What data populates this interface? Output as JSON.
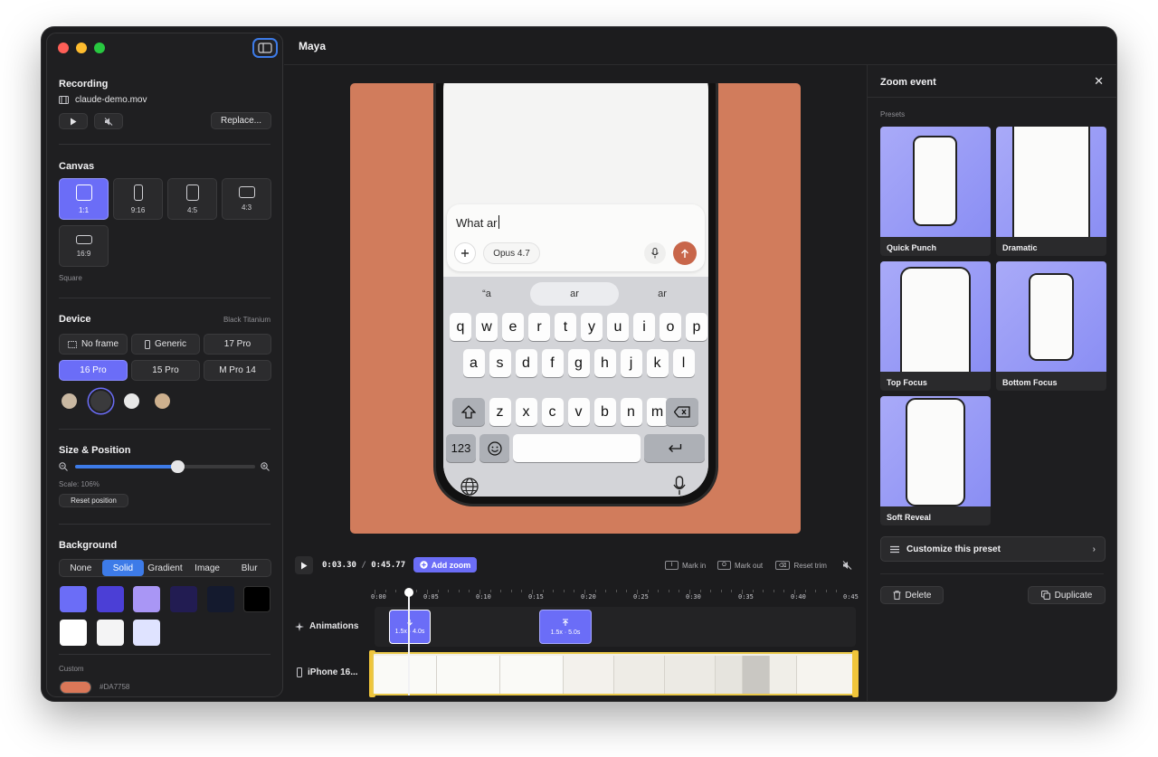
{
  "window": {
    "title": "Maya"
  },
  "recording": {
    "title": "Recording",
    "file_name": "claude-demo.mov",
    "replace_label": "Replace..."
  },
  "canvas": {
    "title": "Canvas",
    "options": [
      "1:1",
      "9:16",
      "4:5",
      "4:3",
      "16:9"
    ],
    "selected": "1:1",
    "selected_name": "Square"
  },
  "device": {
    "title": "Device",
    "finish": "Black Titanium",
    "options": [
      "No frame",
      "Generic",
      "17 Pro",
      "16 Pro",
      "15 Pro",
      "M Pro 14"
    ],
    "selected": "16 Pro",
    "colors": [
      "#c9b8a2",
      "#3a3a3c",
      "#e8e8e8",
      "#cdb08e"
    ]
  },
  "size_position": {
    "title": "Size & Position",
    "scale_text": "Scale: 106%",
    "slider_fraction": 0.57,
    "reset_label": "Reset position"
  },
  "background": {
    "title": "Background",
    "tabs": [
      "None",
      "Solid",
      "Gradient",
      "Image",
      "Blur"
    ],
    "selected_tab": "Solid",
    "swatches": [
      "#6b6df7",
      "#4b3fd6",
      "#a996f5",
      "#221c52",
      "#141a2e",
      "#000000",
      "#ffffff",
      "#f4f4f5",
      "#dfe3ff"
    ],
    "custom_label": "Custom",
    "custom_color": "#DA7758"
  },
  "preview": {
    "input_text": "What ar",
    "model_label": "Opus 4.7",
    "suggestions": [
      "“a",
      "ar",
      "ar"
    ],
    "rows": [
      [
        "q",
        "w",
        "e",
        "r",
        "t",
        "y",
        "u",
        "i",
        "o",
        "p"
      ],
      [
        "a",
        "s",
        "d",
        "f",
        "g",
        "h",
        "j",
        "k",
        "l"
      ],
      [
        "z",
        "x",
        "c",
        "v",
        "b",
        "n",
        "m"
      ]
    ],
    "numbers_key": "123"
  },
  "timeline": {
    "current_time": "0:03.30",
    "separator": "/",
    "total_time": "0:45.77",
    "add_zoom_label": "Add zoom",
    "mark_in": {
      "key": "I",
      "label": "Mark in"
    },
    "mark_out": {
      "key": "O",
      "label": "Mark out"
    },
    "reset_trim": "Reset trim",
    "ticks": [
      "0:00",
      "0:05",
      "0:10",
      "0:15",
      "0:20",
      "0:25",
      "0:30",
      "0:35",
      "0:40",
      "0:45"
    ],
    "tracks": {
      "animations": "Animations",
      "video": "iPhone 16..."
    },
    "clips": [
      {
        "scale": "1.5x",
        "duration": "4.0s"
      },
      {
        "scale": "1.5x",
        "duration": "5.0s"
      }
    ],
    "playhead_seconds": 3.3
  },
  "zoom_event": {
    "title": "Zoom event",
    "presets_label": "Presets",
    "presets": [
      "Quick Punch",
      "Dramatic",
      "Top Focus",
      "Bottom Focus",
      "Soft Reveal"
    ],
    "customize_label": "Customize this preset",
    "delete_label": "Delete",
    "duplicate_label": "Duplicate"
  }
}
